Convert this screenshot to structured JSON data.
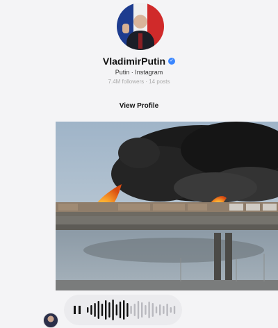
{
  "profile": {
    "username": "VladimirPutin",
    "verified_icon": "check",
    "subtitle": "Putin · Instagram",
    "stats": "7.4M followers · 14 posts",
    "view_profile_label": "View Profile"
  },
  "media": {
    "icon": "image-icon"
  },
  "audio_message": {
    "state_icon": "pause-icon",
    "played_fraction": 0.45
  },
  "colors": {
    "verified": "#3a86ff",
    "bubble": "#ebebee",
    "background": "#f4f4f6"
  }
}
